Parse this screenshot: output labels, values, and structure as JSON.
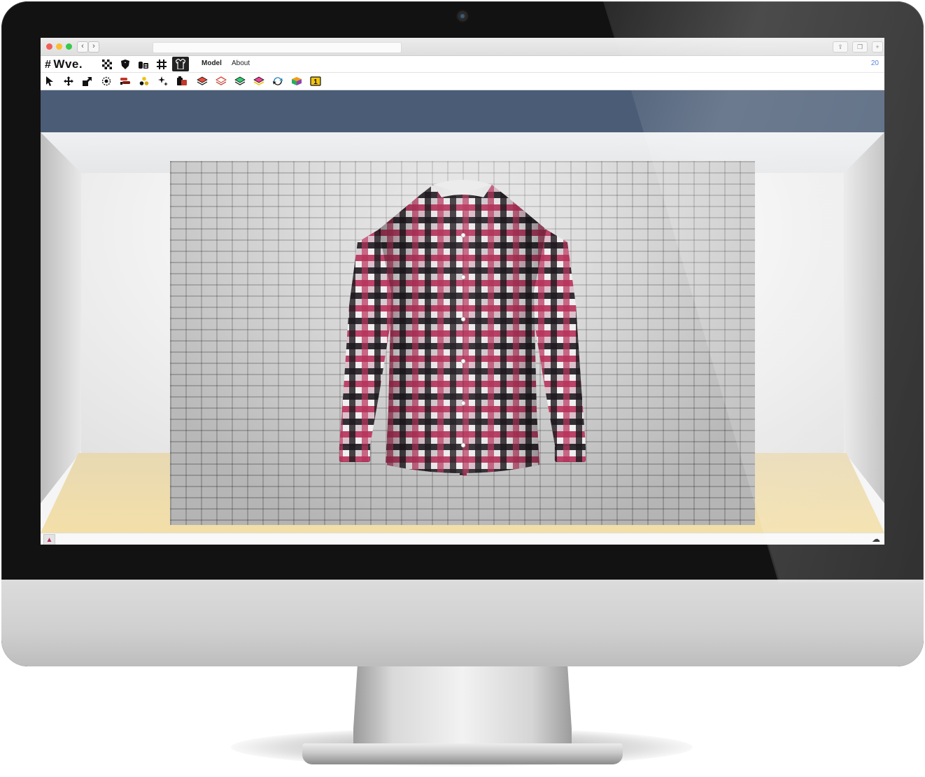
{
  "app": {
    "logo_text": "Wve.",
    "logo_hash": "#"
  },
  "menu": {
    "links": [
      "Model",
      "About"
    ],
    "count": "20"
  },
  "browser": {
    "back": "‹",
    "forward": "›"
  },
  "mode_icons": [
    "pattern-icon",
    "heart-shield-icon",
    "fabric-roll-icon",
    "grid-icon",
    "shirt-front-icon"
  ],
  "tools": [
    "pointer-icon",
    "move-icon",
    "scale-icon",
    "rotate-icon",
    "brush-icon",
    "color-drops-icon",
    "sparkle-icon",
    "layers-stack-icon",
    "layer-red-icon",
    "layer-green-icon",
    "layer-pink-icon",
    "layer-yellow-icon",
    "refresh-icon",
    "palette-cube-icon",
    "number-one-icon"
  ],
  "tool_number": "1",
  "colors": {
    "ceiling": "#4b5d76",
    "floor": "#f3dfa8",
    "plaid_pink": "#b8335c",
    "plaid_black": "#1e1a1f",
    "plaid_white": "#f1eef0",
    "accent_blue": "#3b6fd6"
  }
}
